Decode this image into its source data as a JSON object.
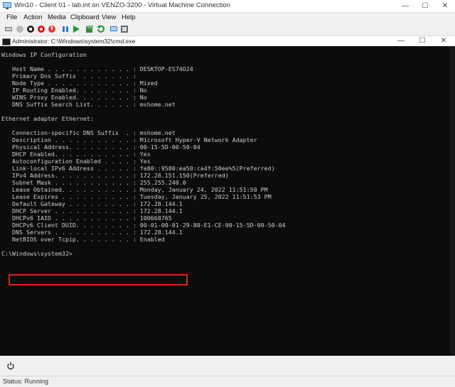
{
  "window": {
    "title": "Win10 - Client 01 - lab.int on VENZO-3200 - Virtual Machine Connection",
    "minimize": "—",
    "maximize": "☐",
    "close": "✕"
  },
  "menu": [
    "File",
    "Action",
    "Media",
    "Clipboard",
    "View",
    "Help"
  ],
  "toolbar_icons": [
    "ctrl-alt-del-icon",
    "start-icon",
    "turn-off-icon",
    "shutdown-icon",
    "power-icon",
    "pause-icon",
    "resume-icon",
    "checkpoint-icon",
    "revert-icon",
    "enhanced-session-icon",
    "share-icon"
  ],
  "cmd": {
    "title": "Administrator: C:\\Windows\\system32\\cmd.exe",
    "minimize": "—",
    "maximize": "☐",
    "close": "✕"
  },
  "console_lines": [
    "Windows IP Configuration",
    "",
    "   Host Name . . . . . . . . . . . . : DESKTOP-ES74O24",
    "   Primary Dns Suffix  . . . . . . . :",
    "   Node Type . . . . . . . . . . . . : Mixed",
    "   IP Routing Enabled. . . . . . . . : No",
    "   WINS Proxy Enabled. . . . . . . . : No",
    "   DNS Suffix Search List. . . . . . : mshome.net",
    "",
    "Ethernet adapter Ethernet:",
    "",
    "   Connection-specific DNS Suffix  . : mshome.net",
    "   Description . . . . . . . . . . . : Microsoft Hyper-V Network Adapter",
    "   Physical Address. . . . . . . . . : 00-15-5D-00-50-04",
    "   DHCP Enabled. . . . . . . . . . . : Yes",
    "   Autoconfiguration Enabled . . . . : Yes",
    "   Link-local IPv6 Address . . . . . : fe80::9580:ea50:ca4f:50ee%5(Preferred)",
    "   IPv4 Address. . . . . . . . . . . : 172.28.151.150(Preferred)",
    "   Subnet Mask . . . . . . . . . . . : 255.255.240.0",
    "   Lease Obtained. . . . . . . . . . : Monday, January 24, 2022 11:51:50 PM",
    "   Lease Expires . . . . . . . . . . : Tuesday, January 25, 2022 11:51:53 PM",
    "   Default Gateway . . . . . . . . . : 172.28.144.1",
    "   DHCP Server . . . . . . . . . . . : 172.28.144.1",
    "   DHCPv6 IAID . . . . . . . . . . . : 100668765",
    "   DHCPv6 Client DUID. . . . . . . . : 00-01-00-01-29-80-E1-CE-00-15-5D-00-50-04",
    "   DNS Servers . . . . . . . . . . . : 172.28.144.1",
    "   NetBIOS over Tcpip. . . . . . . . : Enabled",
    "",
    "C:\\Windows\\system32>"
  ],
  "status": "Status: Running",
  "colors": {
    "highlight": "#e01f1f",
    "console_bg": "#0c0c0c",
    "console_fg": "#cccccc"
  }
}
